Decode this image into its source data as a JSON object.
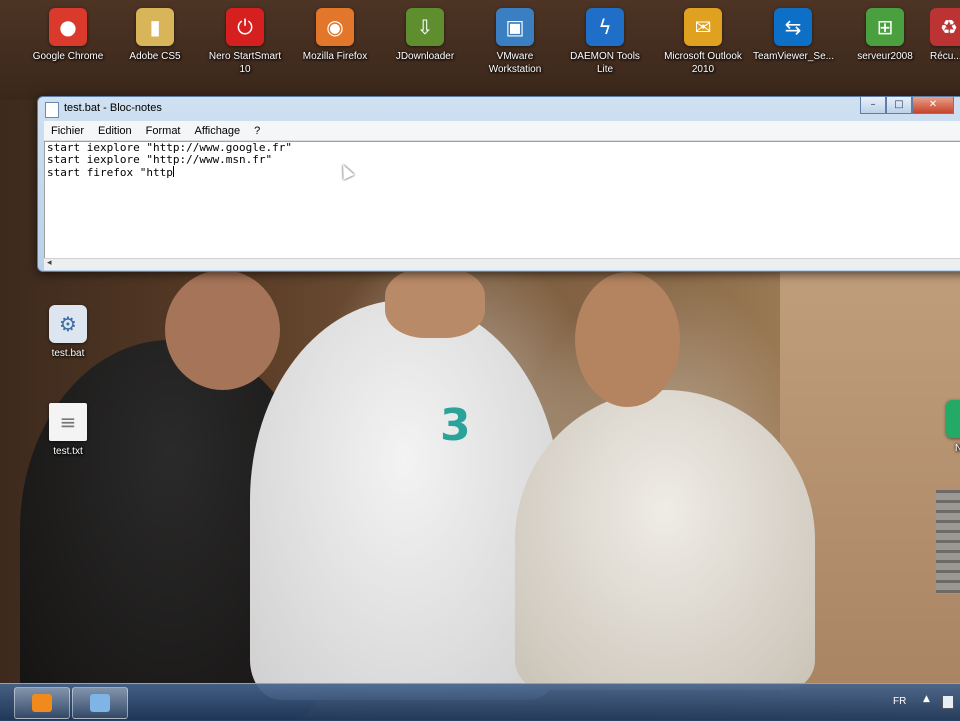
{
  "desktop_icons": {
    "row1": [
      {
        "label": "Google Chrome",
        "icon": "chrome-icon",
        "color": "#d93a2b"
      },
      {
        "label": "Adobe CS5",
        "icon": "folder-icon",
        "color": "#d9b55a"
      },
      {
        "label": "Nero StartSmart 10",
        "icon": "nero-icon",
        "color": "#d62020"
      },
      {
        "label": "Mozilla Firefox",
        "icon": "firefox-icon",
        "color": "#e2762a"
      },
      {
        "label": "JDownloader",
        "icon": "jdownloader-icon",
        "color": "#5f8e2f"
      },
      {
        "label": "VMware Workstation",
        "icon": "vmware-icon",
        "color": "#3a7fc2"
      },
      {
        "label": "DAEMON Tools Lite",
        "icon": "daemon-icon",
        "color": "#1f6fc8"
      },
      {
        "label": "Microsoft Outlook 2010",
        "icon": "outlook-icon",
        "color": "#e0a020"
      },
      {
        "label": "TeamViewer_Se...",
        "icon": "teamviewer-icon",
        "color": "#0e6fc7"
      },
      {
        "label": "serveur2008",
        "icon": "windows-icon",
        "color": "#4aa03f"
      },
      {
        "label": "Récu...",
        "icon": "recycle-icon",
        "color": "#b33"
      }
    ],
    "left": [
      {
        "label": "test.bat",
        "icon": "batch-file-icon",
        "color": "#dde6f0"
      },
      {
        "label": "test.txt",
        "icon": "text-file-icon",
        "color": "#f4f4f4"
      }
    ],
    "right_partial": [
      {
        "label": "Noki",
        "icon": "phone-icon",
        "color": "#2a6"
      }
    ]
  },
  "notepad": {
    "title": "test.bat - Bloc-notes",
    "menu": [
      "Fichier",
      "Edition",
      "Format",
      "Affichage",
      "?"
    ],
    "lines": [
      "start iexplore \"http://www.google.fr\"",
      "start iexplore \"http://www.msn.fr\"",
      "start firefox \"http"
    ],
    "buttons": {
      "minimize": "–",
      "maximize": "□",
      "close": "✕"
    }
  },
  "taskbar": {
    "language": "FR",
    "tray_arrow": "▲",
    "apps": [
      {
        "name": "media-player",
        "color": "#f08a1c"
      },
      {
        "name": "notepad",
        "color": "#7fb4e6"
      }
    ]
  }
}
